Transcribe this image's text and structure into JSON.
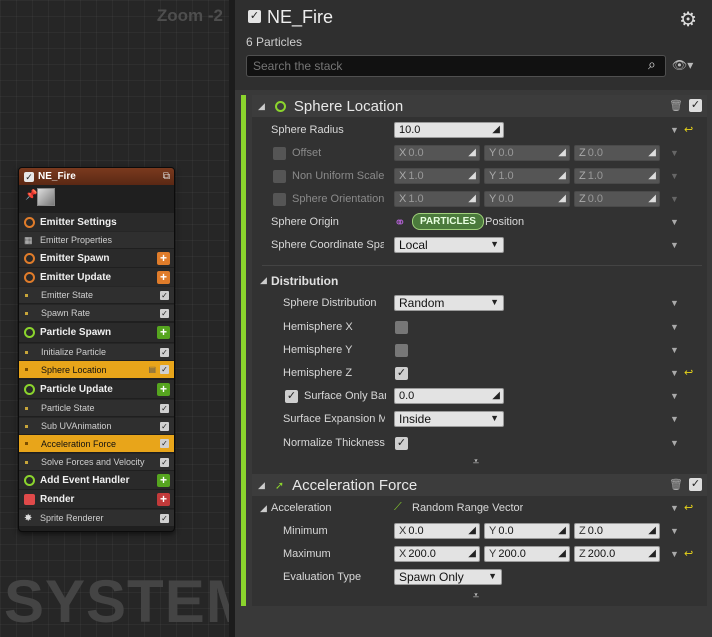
{
  "graph": {
    "zoom_label": "Zoom -2",
    "watermark": "SYSTEM"
  },
  "node": {
    "title": "NE_Fire",
    "rows": [
      {
        "label": "Emitter Settings",
        "kind": "group",
        "icon": "emitter-settings-icon",
        "color": "#e07c2a",
        "add": null,
        "check": false
      },
      {
        "label": "Emitter Properties",
        "kind": "mod",
        "icon": "cpu-icon",
        "color": "#cccccc",
        "add": null,
        "check": false
      },
      {
        "label": "Emitter Spawn",
        "kind": "group",
        "icon": "emitter-spawn-icon",
        "color": "#e07c2a",
        "add": "#e07c2a",
        "check": false
      },
      {
        "label": "Emitter Update",
        "kind": "group",
        "icon": "emitter-update-icon",
        "color": "#e07c2a",
        "add": "#e07c2a",
        "check": false
      },
      {
        "label": "Emitter State",
        "kind": "mod",
        "icon": "",
        "color": "#c7a53a",
        "add": null,
        "check": true
      },
      {
        "label": "Spawn Rate",
        "kind": "mod",
        "icon": "",
        "color": "#c7a53a",
        "add": null,
        "check": true
      },
      {
        "label": "Particle Spawn",
        "kind": "group",
        "icon": "particle-spawn-icon",
        "color": "#8bd42d",
        "add": "#56a51f",
        "check": false
      },
      {
        "label": "Initialize Particle",
        "kind": "mod",
        "icon": "",
        "color": "#c7a53a",
        "add": null,
        "check": true
      },
      {
        "label": "Sphere Location",
        "kind": "sel",
        "icon": "",
        "color": "#c7a53a",
        "add": null,
        "check": true
      },
      {
        "label": "Particle Update",
        "kind": "group",
        "icon": "particle-update-icon",
        "color": "#8bd42d",
        "add": "#56a51f",
        "check": false
      },
      {
        "label": "Particle State",
        "kind": "mod",
        "icon": "",
        "color": "#c7a53a",
        "add": null,
        "check": true
      },
      {
        "label": "Sub UVAnimation",
        "kind": "mod",
        "icon": "",
        "color": "#c7a53a",
        "add": null,
        "check": true
      },
      {
        "label": "Acceleration Force",
        "kind": "sel",
        "icon": "",
        "color": "#c7a53a",
        "add": null,
        "check": true
      },
      {
        "label": "Solve Forces and Velocity",
        "kind": "mod",
        "icon": "",
        "color": "#c7a53a",
        "add": null,
        "check": true
      },
      {
        "label": "Add Event Handler",
        "kind": "group",
        "icon": "event-handler-icon",
        "color": "#8bd42d",
        "add": "#56a51f",
        "check": false
      },
      {
        "label": "Render",
        "kind": "group",
        "icon": "render-icon",
        "color": "#e04a4a",
        "add": "#c23a3a",
        "check": false
      },
      {
        "label": "Sprite Renderer",
        "kind": "mod",
        "icon": "sprite-icon",
        "color": "#dddddd",
        "add": null,
        "check": true
      }
    ]
  },
  "details": {
    "title": "NE_Fire",
    "particle_count": "6 Particles",
    "search_placeholder": "Search the stack"
  },
  "sphere": {
    "title": "Sphere Location",
    "radius_label": "Sphere Radius",
    "radius_value": "10.0",
    "offset_label": "Offset",
    "offset": {
      "x": "0.0",
      "y": "0.0",
      "z": "0.0"
    },
    "scale_label": "Non Uniform Scale",
    "scale": {
      "x": "1.0",
      "y": "1.0",
      "z": "1.0"
    },
    "orient_label": "Sphere Orientation",
    "orient": {
      "x": "1.0",
      "y": "0.0",
      "z": "0.0"
    },
    "origin_label": "Sphere Origin",
    "origin_pill": "PARTICLES",
    "origin_value": "Position",
    "coord_label": "Sphere Coordinate Space",
    "coord_value": "Local",
    "distribution_title": "Distribution",
    "distr_label": "Sphere Distribution",
    "distr_value": "Random",
    "hemi_x_label": "Hemisphere X",
    "hemi_x": false,
    "hemi_y_label": "Hemisphere Y",
    "hemi_y": false,
    "hemi_z_label": "Hemisphere Z",
    "hemi_z": true,
    "surface_label": "Surface Only Band Thickness",
    "surface_value": "0.0",
    "expansion_label": "Surface Expansion Mode",
    "expansion_value": "Inside",
    "normalize_label": "Normalize Thickness",
    "normalize": true
  },
  "accel": {
    "title": "Acceleration Force",
    "accel_label": "Acceleration",
    "accel_value": "Random Range Vector",
    "min_label": "Minimum",
    "min": {
      "x": "0.0",
      "y": "0.0",
      "z": "0.0"
    },
    "max_label": "Maximum",
    "max": {
      "x": "200.0",
      "y": "200.0",
      "z": "200.0"
    },
    "eval_label": "Evaluation Type",
    "eval_value": "Spawn Only"
  },
  "axis": {
    "x": "X",
    "y": "Y",
    "z": "Z"
  },
  "colors": {
    "stripe": "#8bd42d",
    "selection": "#e8a51a",
    "header": "#7a3a1e",
    "reset": "#e5d21a"
  }
}
